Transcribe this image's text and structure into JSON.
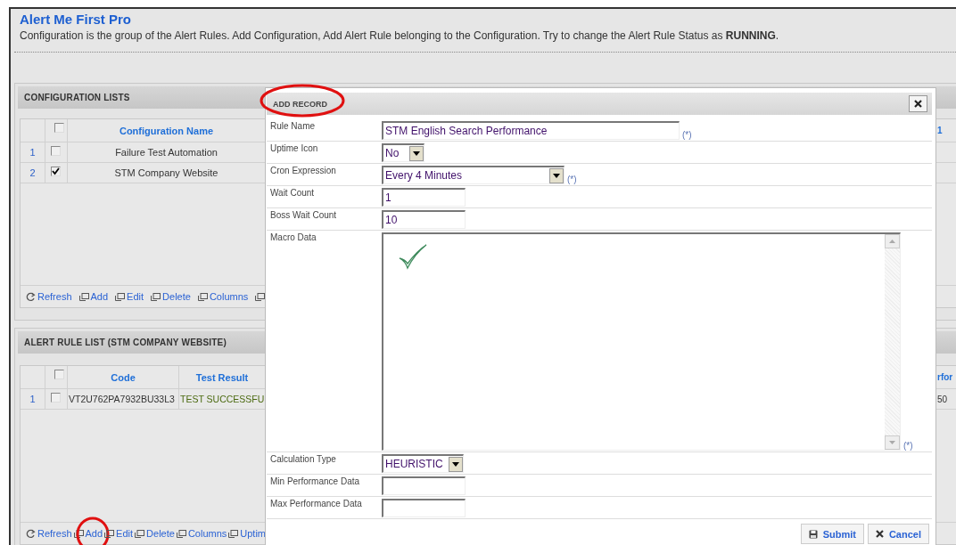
{
  "app": {
    "title": "Alert Me First Pro",
    "description": "Configuration is the group of the Alert Rules. Add Configuration, Add Alert Rule belonging to the Configuration. Try to change the Alert Rule Status as **RUNNING**."
  },
  "configuration_panel": {
    "title": "CONFIGURATION LISTS",
    "header_checked": false,
    "columns": [
      {
        "label": "Configuration Name"
      }
    ],
    "edge_column": "1",
    "rows": [
      {
        "number": "1",
        "checked": false,
        "cells": [
          "Failure Test Automation"
        ]
      },
      {
        "number": "2",
        "checked": true,
        "cells": [
          "STM Company Website"
        ]
      }
    ],
    "toolbar": [
      {
        "kind": "refresh",
        "label": "Refresh",
        "circled": false
      },
      {
        "kind": "window",
        "label": "Add",
        "circled": false
      },
      {
        "kind": "window",
        "label": "Edit",
        "circled": false
      },
      {
        "kind": "window",
        "label": "Delete",
        "circled": false
      },
      {
        "kind": "window",
        "label": "Columns",
        "circled": false
      },
      {
        "kind": "window",
        "circled": false
      }
    ]
  },
  "alert_panel": {
    "title": "ALERT RULE LIST (STM COMPANY WEBSITE)",
    "header_checked": false,
    "columns": [
      {
        "label": "Code"
      },
      {
        "label": "Test Result"
      }
    ],
    "edge_column": "rfor",
    "rows": [
      {
        "number": "1",
        "checked": false,
        "cells": [
          "VT2U762PA7932BU33L3",
          "TEST SUCCESSFU"
        ],
        "edge": "50"
      }
    ],
    "toolbar": [
      {
        "kind": "refresh",
        "label": "Refresh",
        "circled": false
      },
      {
        "kind": "window",
        "label": "Add",
        "circled": true
      },
      {
        "kind": "window",
        "label": "Edit",
        "circled": false
      },
      {
        "kind": "window",
        "label": "Delete",
        "circled": false
      },
      {
        "kind": "window",
        "label": "Columns",
        "circled": false
      },
      {
        "kind": "window",
        "label": "Uptim",
        "circled": false
      }
    ]
  },
  "dialog": {
    "title": "ADD RECORD",
    "circled": true,
    "fields": [
      {
        "label": "Rule Name",
        "kind": "text",
        "value": "STM English Search Performance",
        "note": "(*)"
      },
      {
        "label": "Uptime Icon",
        "kind": "select",
        "value": "No"
      },
      {
        "label": "Cron Expression",
        "kind": "select",
        "value": "Every 4 Minutes",
        "note": "(*)"
      },
      {
        "label": "Wait Count",
        "kind": "text",
        "value": "1"
      },
      {
        "label": "Boss Wait Count",
        "kind": "text",
        "value": "10"
      },
      {
        "label": "Macro Data",
        "kind": "textarea",
        "note": "(*)"
      },
      {
        "label": "Calculation Type",
        "kind": "select",
        "value": "HEURISTIC"
      },
      {
        "label": "Min Performance Data",
        "kind": "text"
      },
      {
        "label": "Max Performance Data",
        "kind": "text"
      }
    ],
    "buttons": [
      {
        "kind": "submit",
        "label": "Submit"
      },
      {
        "kind": "cancel",
        "label": "Cancel"
      }
    ]
  }
}
